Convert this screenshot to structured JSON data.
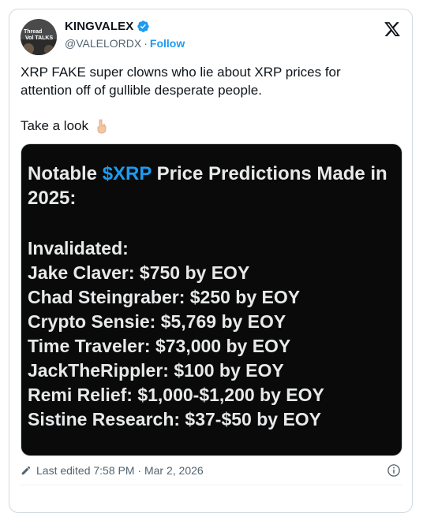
{
  "author": {
    "display_name": "KINGVALEX",
    "handle": "@VALELORDX",
    "separator": "·",
    "follow_label": "Follow",
    "avatar_caption": "Thread Vol TALKS"
  },
  "tweet": {
    "text": "XRP FAKE super clowns who lie about XRP prices for attention off of gullible desperate people.",
    "line3": "Take a look",
    "line3_emoji_icon": "pointing-down-hand-icon"
  },
  "media": {
    "title_prefix": "Notable ",
    "title_accent": "$XRP",
    "title_suffix": " Price Predictions Made in 2025:",
    "subtitle": "Invalidated:",
    "items": [
      "Jake Claver: $750 by EOY",
      "Chad Steingraber: $250 by EOY",
      "Crypto Sensie: $5,769 by EOY",
      "Time Traveler: $73,000 by EOY",
      "JackTheRippler: $100 by EOY",
      "Remi Relief: $1,000-$1,200 by EOY",
      "Sistine Research: $37-$50 by EOY"
    ],
    "accent_color": "#1d9bf0",
    "background_color": "#0a0a0a"
  },
  "footer": {
    "edited_text": "Last edited 7:58 PM · Mar 2, 2026"
  },
  "colors": {
    "brand_blue": "#1d9bf0",
    "text_primary": "#0f1419",
    "text_secondary": "#536471"
  }
}
